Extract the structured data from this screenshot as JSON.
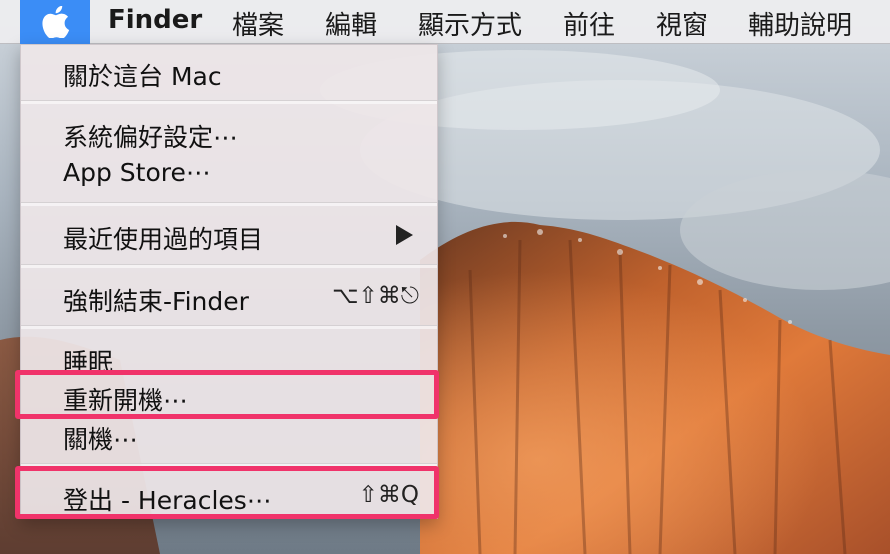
{
  "menubar": {
    "apple_icon": "apple-logo-icon",
    "app_name": "Finder",
    "menus": [
      "檔案",
      "編輯",
      "顯示方式",
      "前往",
      "視窗",
      "輔助說明"
    ]
  },
  "apple_menu": {
    "items": [
      {
        "label": "關於這台 Mac",
        "shortcut": ""
      },
      {
        "label": "系統偏好設定⋯",
        "shortcut": ""
      },
      {
        "label": "App Store⋯",
        "shortcut": ""
      },
      {
        "label": "最近使用過的項目",
        "shortcut": "",
        "submenu_icon": "triangle-right-icon"
      },
      {
        "label": "強制結束-Finder",
        "shortcut": "⌥⇧⌘⎋"
      },
      {
        "label": "睡眠",
        "shortcut": ""
      },
      {
        "label": "重新開機⋯",
        "shortcut": ""
      },
      {
        "label": "關機⋯",
        "shortcut": ""
      },
      {
        "label": "登出 - Heracles⋯",
        "shortcut": "⇧⌘Q"
      }
    ]
  },
  "colors": {
    "apple_highlight": "#3b8df6",
    "annotation_box": "#f0336a"
  }
}
